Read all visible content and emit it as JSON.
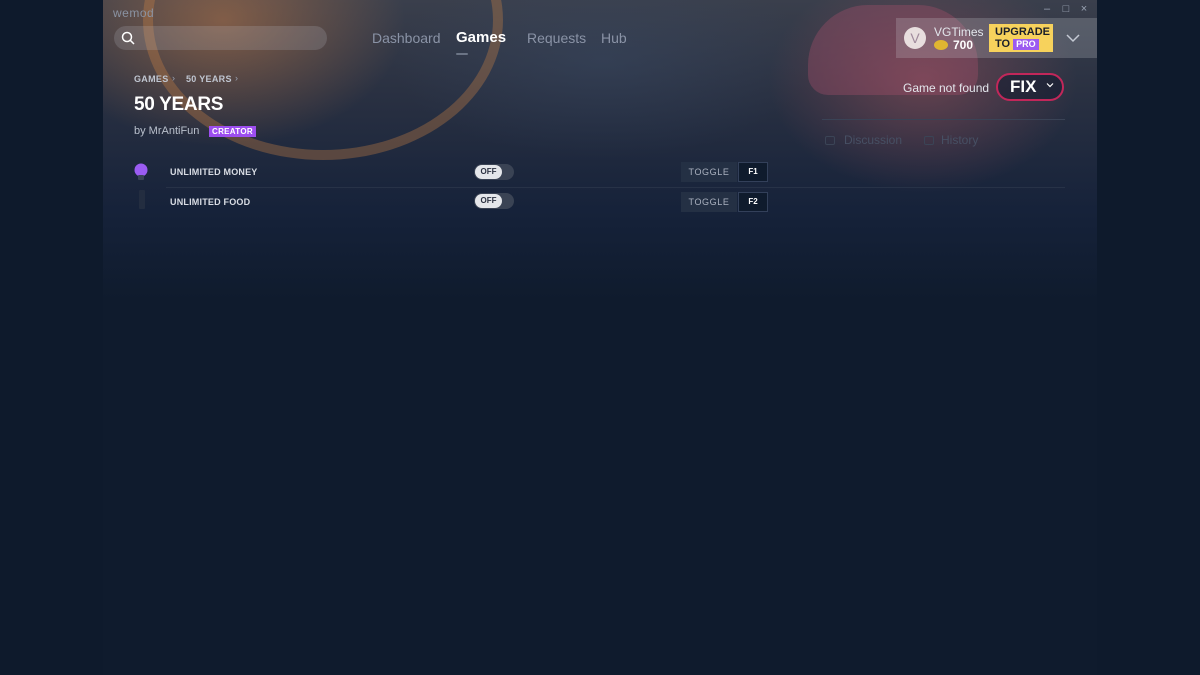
{
  "app": {
    "name": "wemod",
    "window_controls": {
      "minimize": "–",
      "maximize": "□",
      "close": "×"
    }
  },
  "header": {
    "search": {
      "placeholder": ""
    },
    "nav": [
      {
        "label": "Dashboard",
        "active": false
      },
      {
        "label": "Games",
        "active": true
      },
      {
        "label": "Requests",
        "active": false
      },
      {
        "label": "Hub",
        "active": false
      }
    ],
    "user": {
      "avatar_letter": "V",
      "name": "VGTimes",
      "coins": "700",
      "upgrade_label": "UPGRADE",
      "upgrade_to": "TO",
      "pro_label": "PRO"
    }
  },
  "breadcrumb": [
    "GAMES",
    "50 YEARS"
  ],
  "game": {
    "title": "50 YEARS",
    "by": "by MrAntiFun",
    "creator_badge": "CREATOR"
  },
  "status": {
    "message": "Game not found",
    "fix_label": "FIX"
  },
  "side_tabs": [
    {
      "label": "Discussion",
      "icon": "chat-icon"
    },
    {
      "label": "History",
      "icon": "history-icon"
    }
  ],
  "cheats": [
    {
      "name": "UNLIMITED MONEY",
      "state": "OFF",
      "action": "TOGGLE",
      "key": "F1"
    },
    {
      "name": "UNLIMITED FOOD",
      "state": "OFF",
      "action": "TOGGLE",
      "key": "F2"
    }
  ],
  "colors": {
    "background": "#0f1b2d",
    "accent_purple": "#9d4ef0",
    "fix_border": "#c2275a",
    "upgrade_yellow": "#f7d25c"
  }
}
